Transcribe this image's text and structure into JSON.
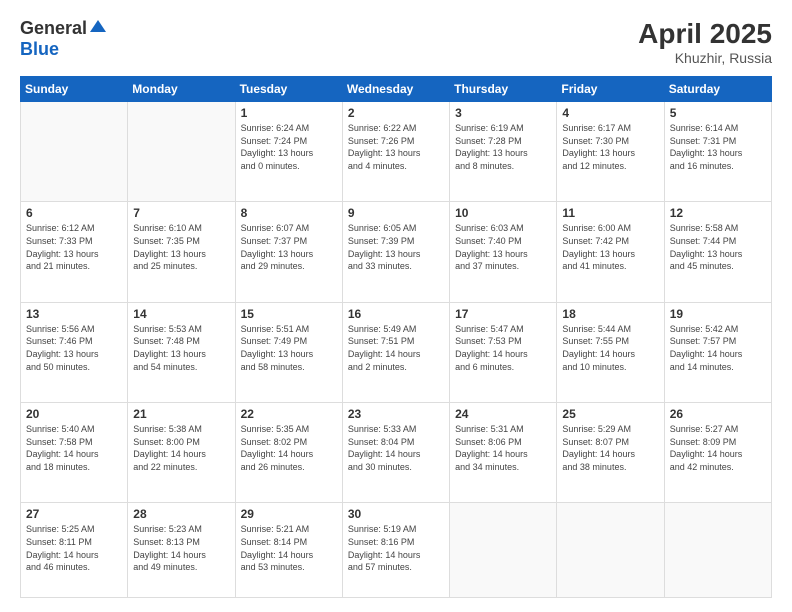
{
  "header": {
    "logo_general": "General",
    "logo_blue": "Blue",
    "title": "April 2025",
    "location": "Khuzhir, Russia"
  },
  "days_of_week": [
    "Sunday",
    "Monday",
    "Tuesday",
    "Wednesday",
    "Thursday",
    "Friday",
    "Saturday"
  ],
  "weeks": [
    [
      {
        "day": "",
        "info": ""
      },
      {
        "day": "",
        "info": ""
      },
      {
        "day": "1",
        "info": "Sunrise: 6:24 AM\nSunset: 7:24 PM\nDaylight: 13 hours\nand 0 minutes."
      },
      {
        "day": "2",
        "info": "Sunrise: 6:22 AM\nSunset: 7:26 PM\nDaylight: 13 hours\nand 4 minutes."
      },
      {
        "day": "3",
        "info": "Sunrise: 6:19 AM\nSunset: 7:28 PM\nDaylight: 13 hours\nand 8 minutes."
      },
      {
        "day": "4",
        "info": "Sunrise: 6:17 AM\nSunset: 7:30 PM\nDaylight: 13 hours\nand 12 minutes."
      },
      {
        "day": "5",
        "info": "Sunrise: 6:14 AM\nSunset: 7:31 PM\nDaylight: 13 hours\nand 16 minutes."
      }
    ],
    [
      {
        "day": "6",
        "info": "Sunrise: 6:12 AM\nSunset: 7:33 PM\nDaylight: 13 hours\nand 21 minutes."
      },
      {
        "day": "7",
        "info": "Sunrise: 6:10 AM\nSunset: 7:35 PM\nDaylight: 13 hours\nand 25 minutes."
      },
      {
        "day": "8",
        "info": "Sunrise: 6:07 AM\nSunset: 7:37 PM\nDaylight: 13 hours\nand 29 minutes."
      },
      {
        "day": "9",
        "info": "Sunrise: 6:05 AM\nSunset: 7:39 PM\nDaylight: 13 hours\nand 33 minutes."
      },
      {
        "day": "10",
        "info": "Sunrise: 6:03 AM\nSunset: 7:40 PM\nDaylight: 13 hours\nand 37 minutes."
      },
      {
        "day": "11",
        "info": "Sunrise: 6:00 AM\nSunset: 7:42 PM\nDaylight: 13 hours\nand 41 minutes."
      },
      {
        "day": "12",
        "info": "Sunrise: 5:58 AM\nSunset: 7:44 PM\nDaylight: 13 hours\nand 45 minutes."
      }
    ],
    [
      {
        "day": "13",
        "info": "Sunrise: 5:56 AM\nSunset: 7:46 PM\nDaylight: 13 hours\nand 50 minutes."
      },
      {
        "day": "14",
        "info": "Sunrise: 5:53 AM\nSunset: 7:48 PM\nDaylight: 13 hours\nand 54 minutes."
      },
      {
        "day": "15",
        "info": "Sunrise: 5:51 AM\nSunset: 7:49 PM\nDaylight: 13 hours\nand 58 minutes."
      },
      {
        "day": "16",
        "info": "Sunrise: 5:49 AM\nSunset: 7:51 PM\nDaylight: 14 hours\nand 2 minutes."
      },
      {
        "day": "17",
        "info": "Sunrise: 5:47 AM\nSunset: 7:53 PM\nDaylight: 14 hours\nand 6 minutes."
      },
      {
        "day": "18",
        "info": "Sunrise: 5:44 AM\nSunset: 7:55 PM\nDaylight: 14 hours\nand 10 minutes."
      },
      {
        "day": "19",
        "info": "Sunrise: 5:42 AM\nSunset: 7:57 PM\nDaylight: 14 hours\nand 14 minutes."
      }
    ],
    [
      {
        "day": "20",
        "info": "Sunrise: 5:40 AM\nSunset: 7:58 PM\nDaylight: 14 hours\nand 18 minutes."
      },
      {
        "day": "21",
        "info": "Sunrise: 5:38 AM\nSunset: 8:00 PM\nDaylight: 14 hours\nand 22 minutes."
      },
      {
        "day": "22",
        "info": "Sunrise: 5:35 AM\nSunset: 8:02 PM\nDaylight: 14 hours\nand 26 minutes."
      },
      {
        "day": "23",
        "info": "Sunrise: 5:33 AM\nSunset: 8:04 PM\nDaylight: 14 hours\nand 30 minutes."
      },
      {
        "day": "24",
        "info": "Sunrise: 5:31 AM\nSunset: 8:06 PM\nDaylight: 14 hours\nand 34 minutes."
      },
      {
        "day": "25",
        "info": "Sunrise: 5:29 AM\nSunset: 8:07 PM\nDaylight: 14 hours\nand 38 minutes."
      },
      {
        "day": "26",
        "info": "Sunrise: 5:27 AM\nSunset: 8:09 PM\nDaylight: 14 hours\nand 42 minutes."
      }
    ],
    [
      {
        "day": "27",
        "info": "Sunrise: 5:25 AM\nSunset: 8:11 PM\nDaylight: 14 hours\nand 46 minutes."
      },
      {
        "day": "28",
        "info": "Sunrise: 5:23 AM\nSunset: 8:13 PM\nDaylight: 14 hours\nand 49 minutes."
      },
      {
        "day": "29",
        "info": "Sunrise: 5:21 AM\nSunset: 8:14 PM\nDaylight: 14 hours\nand 53 minutes."
      },
      {
        "day": "30",
        "info": "Sunrise: 5:19 AM\nSunset: 8:16 PM\nDaylight: 14 hours\nand 57 minutes."
      },
      {
        "day": "",
        "info": ""
      },
      {
        "day": "",
        "info": ""
      },
      {
        "day": "",
        "info": ""
      }
    ]
  ]
}
